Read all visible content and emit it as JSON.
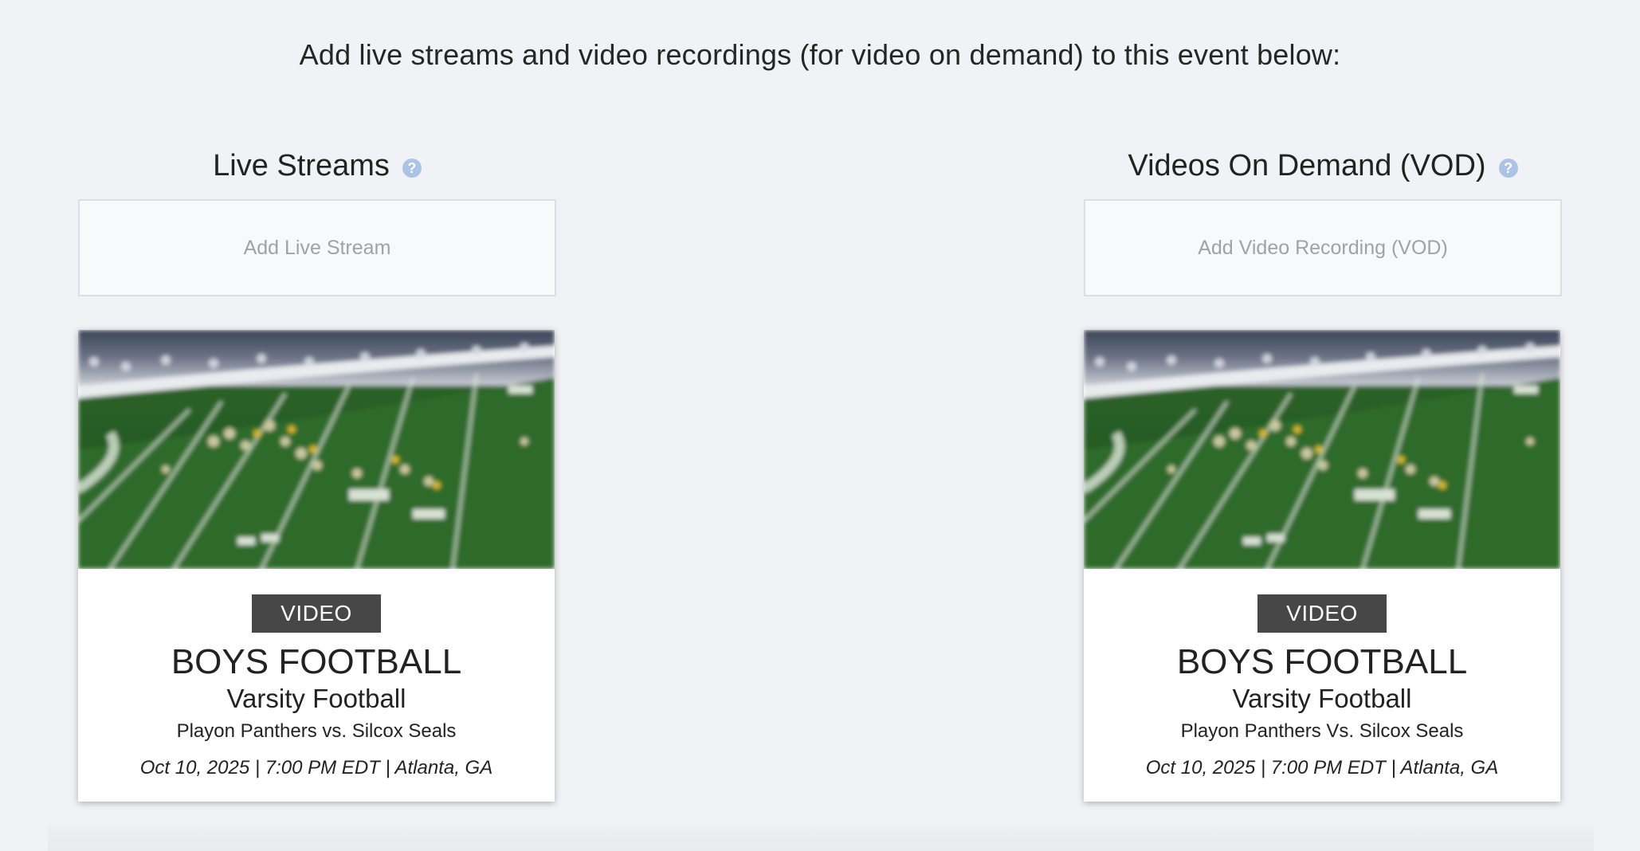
{
  "intro_text": "Add live streams and video recordings (for video on demand) to this event below:",
  "help_icon_glyph": "?",
  "colors": {
    "background": "#f1f2f6",
    "help_icon": "#a9c4e6",
    "badge": "#474747"
  },
  "live_streams": {
    "heading": "Live Streams",
    "add_label": "Add Live Stream",
    "card": {
      "thumbnail_icon": "football-field-image",
      "badge": "VIDEO",
      "sport": "BOYS FOOTBALL",
      "level": "Varsity Football",
      "matchup": "Playon Panthers vs. Silcox Seals",
      "meta": "Oct 10, 2025 | 7:00 PM EDT | Atlanta, GA"
    }
  },
  "vod": {
    "heading": "Videos On Demand (VOD)",
    "add_label": "Add Video Recording (VOD)",
    "card": {
      "thumbnail_icon": "football-field-image",
      "badge": "VIDEO",
      "sport": "BOYS FOOTBALL",
      "level": "Varsity Football",
      "matchup": "Playon Panthers Vs. Silcox Seals",
      "meta": "Oct 10, 2025 | 7:00 PM EDT | Atlanta, GA"
    }
  }
}
